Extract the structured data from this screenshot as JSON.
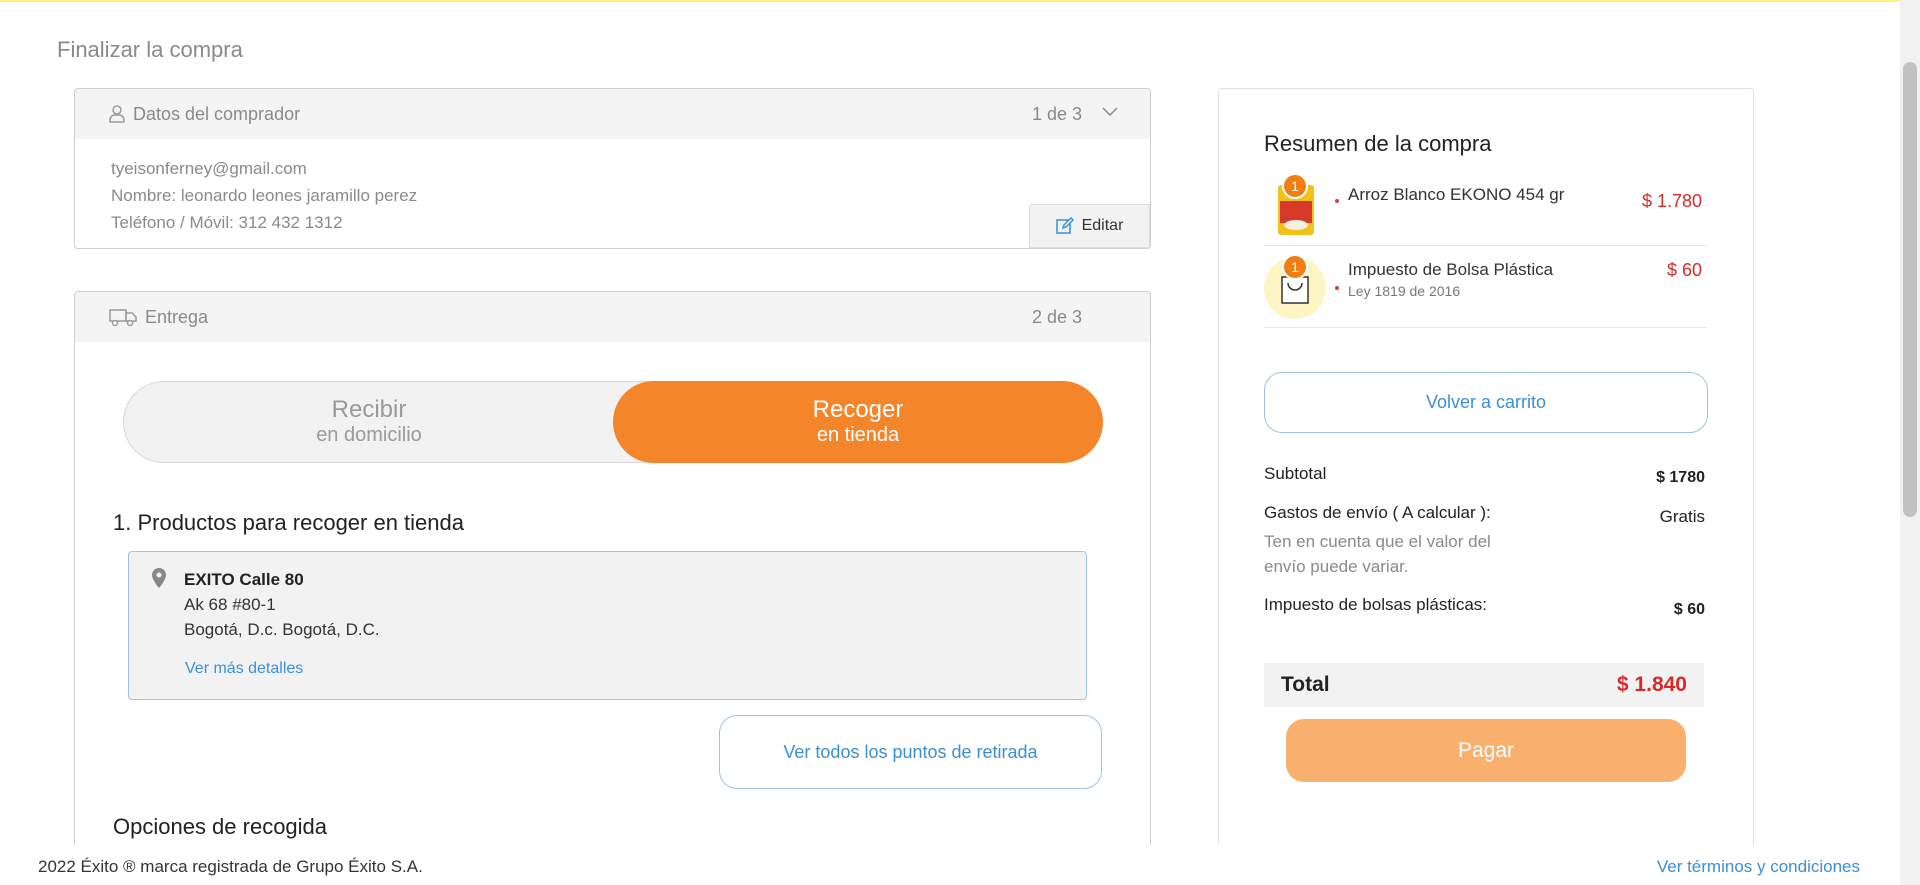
{
  "page_title": "Finalizar la compra",
  "buyer": {
    "title": "Datos del comprador",
    "step": "1 de 3",
    "email": "tyeisonferney@gmail.com",
    "name_line": "Nombre: leonardo leones jaramillo perez",
    "phone_line": "Teléfono / Móvil: 312 432 1312",
    "edit_label": "Editar"
  },
  "delivery": {
    "title": "Entrega",
    "step": "2 de 3",
    "toggle": {
      "left_line1": "Recibir",
      "left_line2": "en domicilio",
      "right_line1": "Recoger",
      "right_line2": "en tienda"
    },
    "section1": "1. Productos para recoger en tienda",
    "store": {
      "name": "EXITO Calle 80",
      "address": "Ak 68 #80-1",
      "city": "Bogotá, D.c. Bogotá, D.C.",
      "details_link": "Ver más detalles"
    },
    "points_button": "Ver todos los puntos de retirada",
    "section2": "Opciones de recogida"
  },
  "summary": {
    "title": "Resumen de la compra",
    "items": [
      {
        "qty": "1",
        "name": "Arroz Blanco EKONO 454 gr",
        "sub": "",
        "price": "$ 1.780"
      },
      {
        "qty": "1",
        "name": "Impuesto de Bolsa Plástica",
        "sub": "Ley 1819 de 2016",
        "price": "$ 60"
      }
    ],
    "back_button": "Volver a carrito",
    "subtotal_label": "Subtotal",
    "subtotal_value": "$ 1780",
    "shipping_label": "Gastos de envío ( A calcular ):",
    "shipping_value": "Gratis",
    "shipping_note": "Ten en cuenta que el valor del envío puede variar.",
    "bags_label": "Impuesto de bolsas plásticas:",
    "bags_value": "$ 60",
    "total_label": "Total",
    "total_value": "$ 1.840",
    "pay_button": "Pagar"
  },
  "footer": {
    "copyright": "2022 Éxito ® marca registrada de Grupo Éxito S.A.",
    "terms": "Ver términos y condiciones"
  },
  "colors": {
    "accent_orange": "#f5852a",
    "pay_orange": "#f9b06f",
    "price_red": "#d62b2b",
    "link_blue": "#3a8fd9"
  }
}
